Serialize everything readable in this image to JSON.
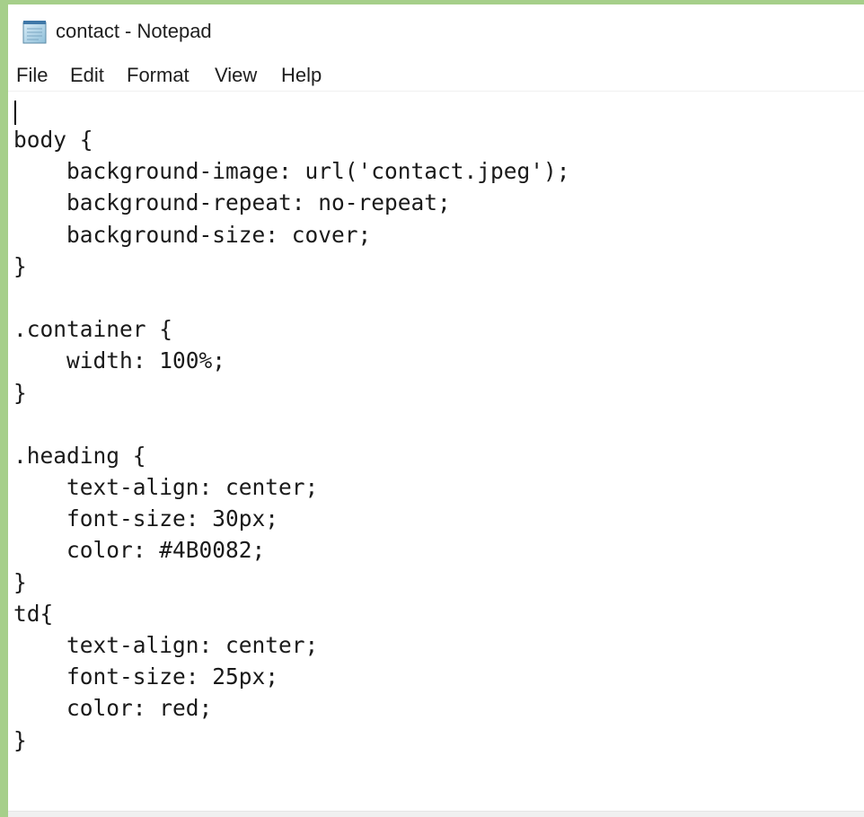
{
  "window": {
    "title": "contact - Notepad",
    "icon": "notepad-icon"
  },
  "menubar": {
    "items": [
      {
        "label": "File"
      },
      {
        "label": "Edit"
      },
      {
        "label": "Format"
      },
      {
        "label": "View"
      },
      {
        "label": "Help"
      }
    ]
  },
  "editor": {
    "lines": [
      "body {",
      "    background-image: url('contact.jpeg');",
      "    background-repeat: no-repeat;",
      "    background-size: cover;",
      "}",
      "",
      ".container {",
      "    width: 100%;",
      "}",
      "",
      ".heading {",
      "    text-align: center;",
      "    font-size: 30px;",
      "    color: #4B0082;",
      "}",
      "td{",
      "    text-align: center;",
      "    font-size: 25px;",
      "    color: red;",
      "}"
    ]
  },
  "colors": {
    "desktop_border": "#a6cf8a",
    "window_background": "#ffffff",
    "text": "#1a1a1a"
  }
}
